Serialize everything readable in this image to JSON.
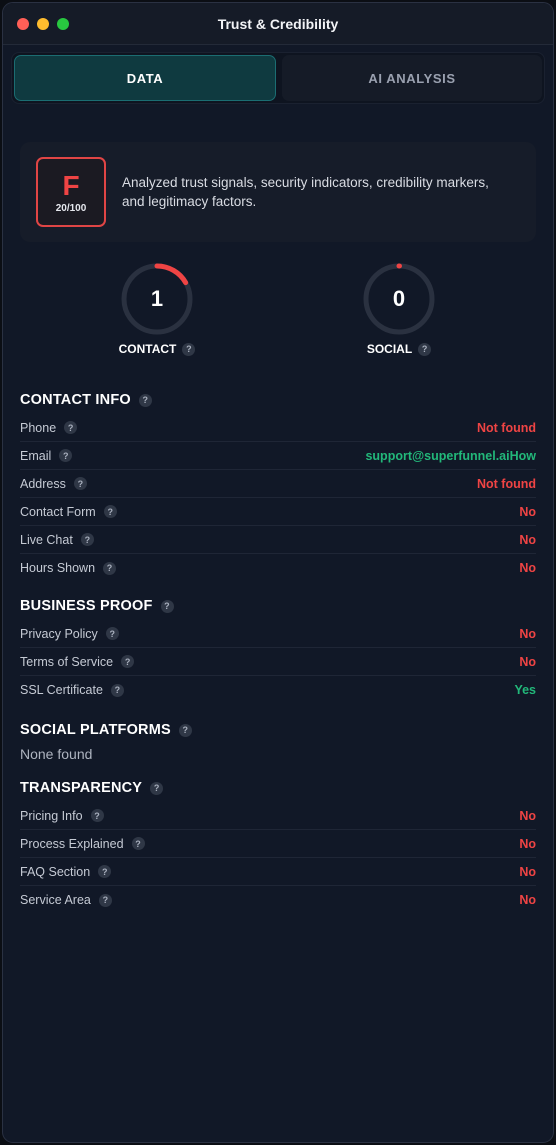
{
  "window": {
    "title": "Trust & Credibility"
  },
  "tabs": [
    {
      "label": "DATA",
      "active": true
    },
    {
      "label": "AI ANALYSIS",
      "active": false
    }
  ],
  "score": {
    "grade": "F",
    "score_text": "20/100",
    "description": "Analyzed trust signals, security indicators, credibility markers, and legitimacy factors."
  },
  "gauges": {
    "contact": {
      "value": "1",
      "label": "CONTACT",
      "fraction": 0.167
    },
    "social": {
      "value": "0",
      "label": "SOCIAL",
      "fraction": 0.0
    }
  },
  "contact_info": {
    "title": "CONTACT INFO",
    "rows": [
      {
        "label": "Phone",
        "value": "Not found",
        "status": "bad"
      },
      {
        "label": "Email",
        "value": "support@superfunnel.aiHow",
        "status": "good"
      },
      {
        "label": "Address",
        "value": "Not found",
        "status": "bad"
      },
      {
        "label": "Contact Form",
        "value": "No",
        "status": "bad"
      },
      {
        "label": "Live Chat",
        "value": "No",
        "status": "bad"
      },
      {
        "label": "Hours Shown",
        "value": "No",
        "status": "bad"
      }
    ]
  },
  "business_proof": {
    "title": "BUSINESS PROOF",
    "rows": [
      {
        "label": "Privacy Policy",
        "value": "No",
        "status": "bad"
      },
      {
        "label": "Terms of Service",
        "value": "No",
        "status": "bad"
      },
      {
        "label": "SSL Certificate",
        "value": "Yes",
        "status": "good"
      }
    ]
  },
  "social_platforms": {
    "title": "SOCIAL PLATFORMS",
    "empty_text": "None found"
  },
  "transparency": {
    "title": "TRANSPARENCY",
    "rows": [
      {
        "label": "Pricing Info",
        "value": "No",
        "status": "bad"
      },
      {
        "label": "Process Explained",
        "value": "No",
        "status": "bad"
      },
      {
        "label": "FAQ Section",
        "value": "No",
        "status": "bad"
      },
      {
        "label": "Service Area",
        "value": "No",
        "status": "bad"
      }
    ]
  },
  "help_glyph": "?",
  "colors": {
    "bad": "#ef4444",
    "good": "#22b87a",
    "accent": "#1b6d72"
  }
}
